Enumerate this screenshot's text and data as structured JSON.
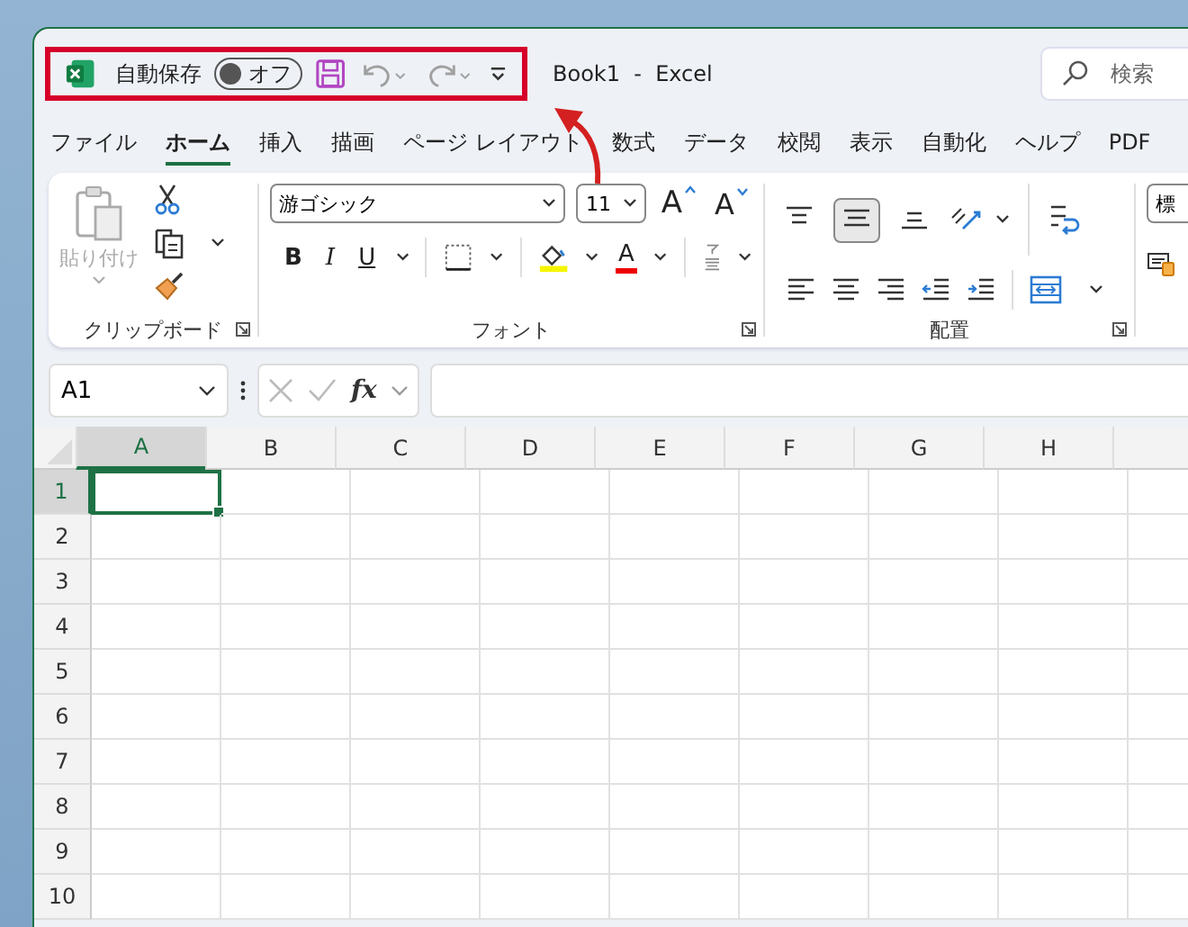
{
  "title_bar": {
    "autosave": {
      "label": "自動保存",
      "on": false,
      "state_label": "オフ"
    },
    "quick_access": [
      {
        "kind": "save",
        "disabled": false
      },
      {
        "kind": "undo",
        "disabled": true
      },
      {
        "kind": "redo",
        "disabled": true
      },
      {
        "kind": "customize",
        "disabled": false
      }
    ],
    "title": "Book1  -  Excel",
    "search": {
      "placeholder": "検索"
    }
  },
  "tabs": [
    {
      "label": "ファイル",
      "selected": false
    },
    {
      "label": "ホーム",
      "selected": true
    },
    {
      "label": "挿入",
      "selected": false
    },
    {
      "label": "描画",
      "selected": false
    },
    {
      "label": "ページ レイアウト",
      "selected": false
    },
    {
      "label": "数式",
      "selected": false
    },
    {
      "label": "データ",
      "selected": false
    },
    {
      "label": "校閲",
      "selected": false
    },
    {
      "label": "表示",
      "selected": false
    },
    {
      "label": "自動化",
      "selected": false
    },
    {
      "label": "ヘルプ",
      "selected": false
    },
    {
      "label": "PDF",
      "selected": false
    }
  ],
  "ribbon": {
    "clipboard": {
      "paste": {
        "label": "貼り付け",
        "disabled": true
      },
      "label": "クリップボード"
    },
    "font": {
      "font_name": "游ゴシック",
      "font_size": "11",
      "grow": "A",
      "shrink": "A",
      "bold": "B",
      "italic": "I",
      "underline": "U",
      "font_color": "A",
      "label": "フォント"
    },
    "alignment": {
      "vertical": [
        {
          "kind": "top",
          "selected": false
        },
        {
          "kind": "middle",
          "selected": true
        },
        {
          "kind": "bottom",
          "selected": false
        }
      ],
      "label": "配置"
    },
    "number": {
      "format": "標"
    }
  },
  "formula_bar": {
    "name_box": "A1",
    "function": "fx"
  },
  "sheet": {
    "columns": [
      {
        "label": "A",
        "selected": true
      },
      {
        "label": "B",
        "selected": false
      },
      {
        "label": "C",
        "selected": false
      },
      {
        "label": "D",
        "selected": false
      },
      {
        "label": "E",
        "selected": false
      },
      {
        "label": "F",
        "selected": false
      },
      {
        "label": "G",
        "selected": false
      },
      {
        "label": "H",
        "selected": false
      }
    ],
    "rows": [
      {
        "label": "1",
        "selected": true
      },
      {
        "label": "2",
        "selected": false
      },
      {
        "label": "3",
        "selected": false
      },
      {
        "label": "4",
        "selected": false
      },
      {
        "label": "5",
        "selected": false
      },
      {
        "label": "6",
        "selected": false
      },
      {
        "label": "7",
        "selected": false
      },
      {
        "label": "8",
        "selected": false
      },
      {
        "label": "9",
        "selected": false
      },
      {
        "label": "10",
        "selected": false
      }
    ]
  }
}
